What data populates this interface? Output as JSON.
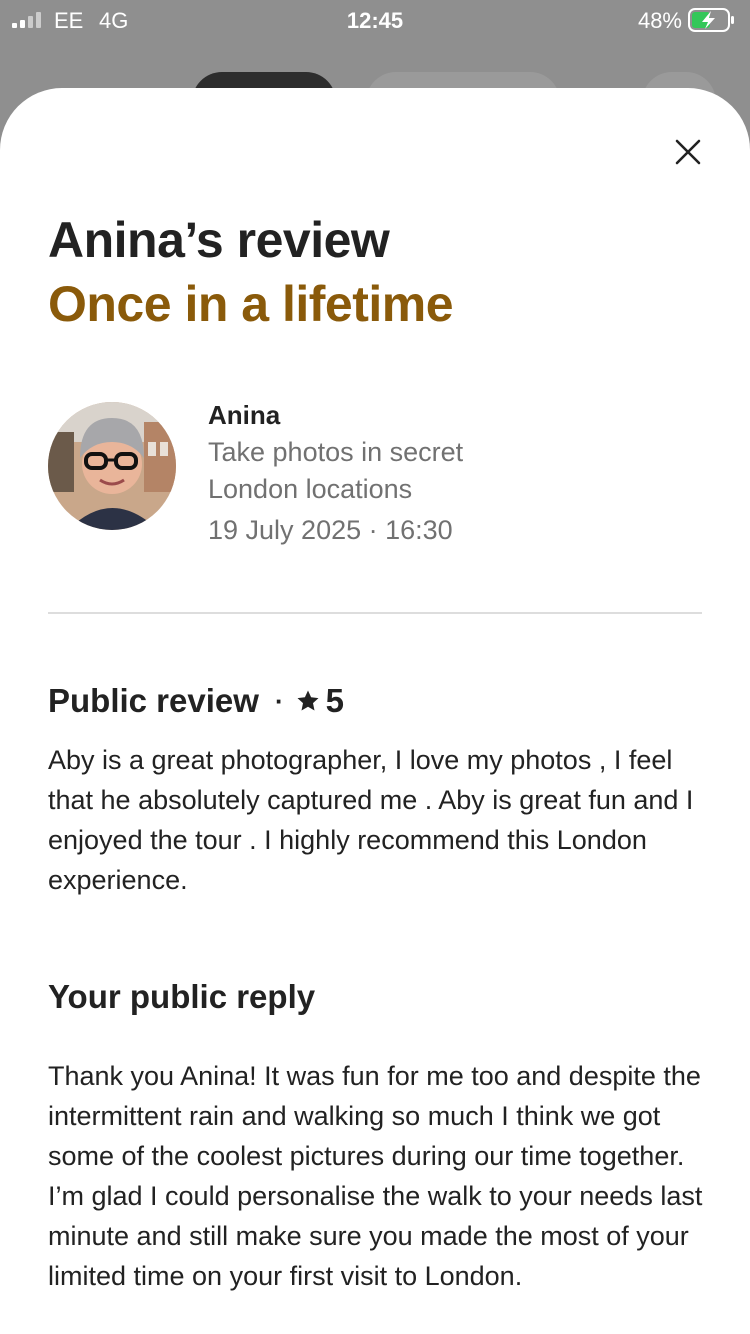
{
  "status_bar": {
    "carrier": "EE",
    "network": "4G",
    "time": "12:45",
    "battery_percent": "48%"
  },
  "review": {
    "title": "Anina’s review",
    "headline": "Once in a lifetime",
    "reviewer": {
      "name": "Anina",
      "experience_line1": "Take photos in secret",
      "experience_line2": "London locations",
      "date": "19 July 2025 · 16:30"
    },
    "public_review": {
      "heading": "Public review",
      "separator": "·",
      "rating": "5",
      "text": "Aby is a great photographer, I love my photos , I feel that he absolutely captured me . Aby is great fun and I enjoyed the tour . I highly recommend this London experience."
    },
    "public_reply": {
      "heading": "Your public reply",
      "text": "Thank you Anina! It was fun for me too and despite the intermittent rain and walking so much I think we got some of the coolest pictures during our time together. I’m glad I could personalise the walk to your needs last minute and still make sure you made the most of your limited time on your first visit to London."
    }
  },
  "icons": {
    "close": "close-icon",
    "star": "star-icon",
    "signal": "signal-icon",
    "battery": "battery-charging-icon"
  },
  "colors": {
    "headline": "#8a5a0a",
    "secondary_text": "#717171",
    "primary_text": "#222222",
    "divider": "#dddddd"
  }
}
